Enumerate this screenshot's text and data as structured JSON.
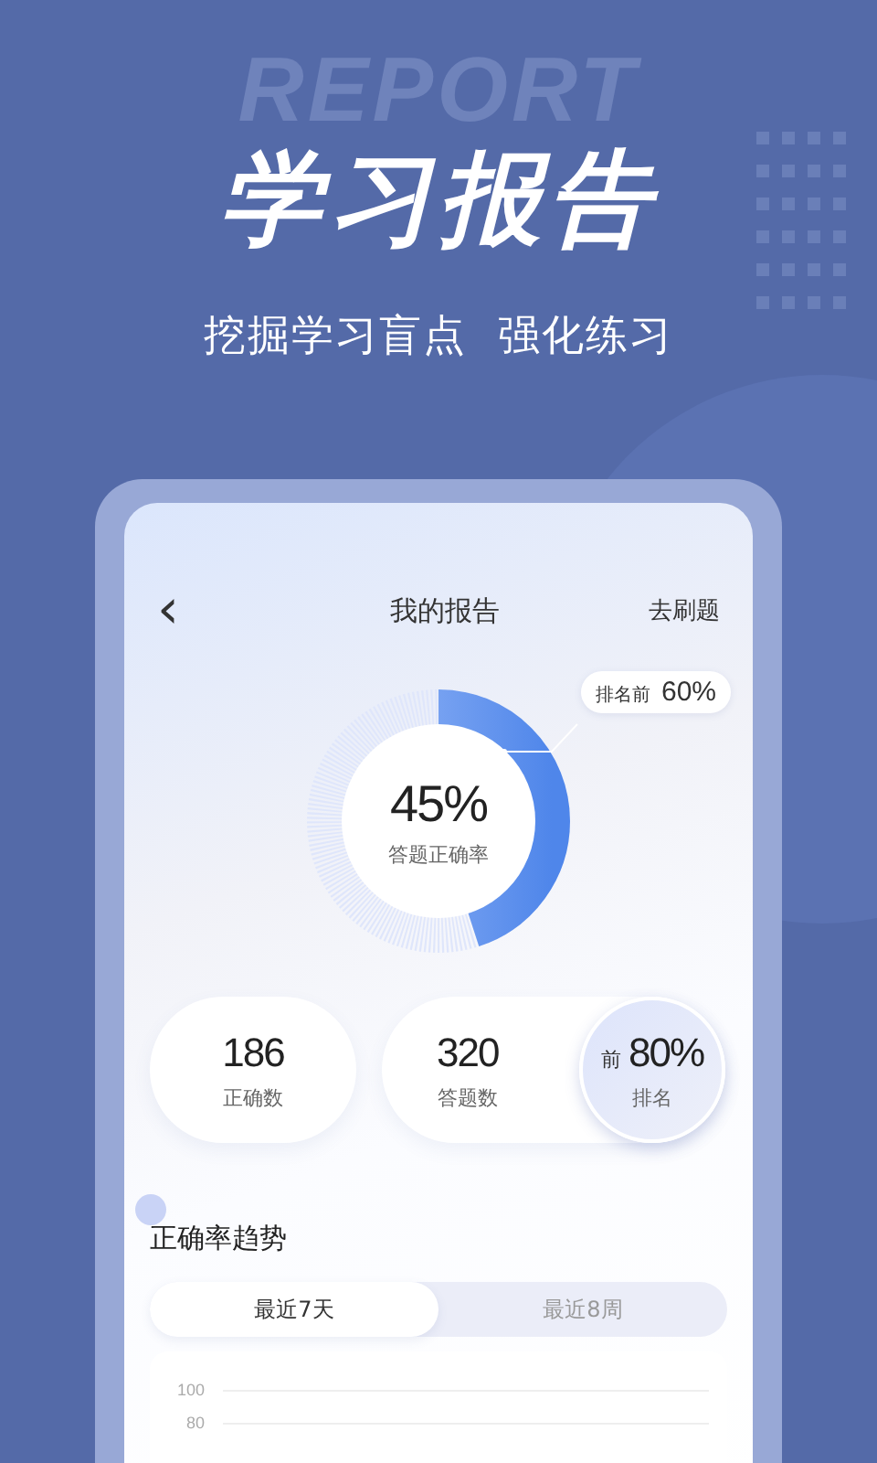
{
  "banner": {
    "background_word": "REPORT",
    "title": "学习报告",
    "subtitle": "挖掘学习盲点  强化练习"
  },
  "screen": {
    "nav": {
      "back": "‹",
      "title": "我的报告",
      "action": "去刷题"
    },
    "accuracy_ring": {
      "value": "45%",
      "label": "答题正确率",
      "level": 0.45,
      "callout_label": "排名前",
      "callout_value": "60%"
    },
    "stats": [
      {
        "kind": "plain",
        "value": "186",
        "label": "正确数"
      },
      {
        "kind": "plain",
        "value": "320",
        "label": "答题数"
      },
      {
        "kind": "rank",
        "prefix": "前",
        "value": "80%",
        "label": "排名"
      }
    ],
    "trend": {
      "title": "正确率趋势",
      "tabs": [
        {
          "label": "最近7天",
          "selected": true
        },
        {
          "label": "最近8周",
          "selected": false
        }
      ],
      "y_tick_labels": [
        "100",
        "80"
      ]
    }
  }
}
